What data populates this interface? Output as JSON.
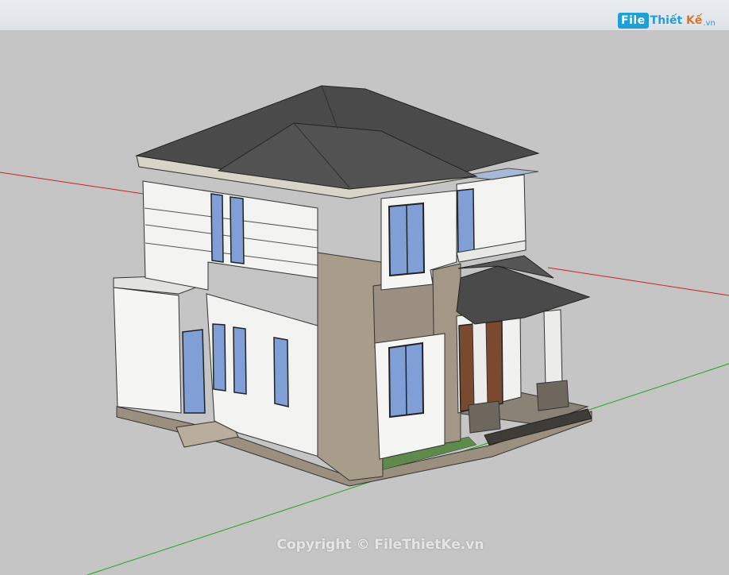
{
  "watermark": {
    "logo_badge": "File",
    "logo_name": "Thiết",
    "logo_name_2": "Kế",
    "logo_tld": ".vn",
    "copyright": "Copyright © FileThietKe.vn"
  },
  "colors": {
    "axis_red": "#d42020",
    "axis_green": "#1aa61a",
    "roof": "#4a4a4a",
    "wall": "#f4f4f2",
    "stone": "#a89c8a",
    "glass": "#7f9fd6",
    "background": "#c5c5c5"
  }
}
